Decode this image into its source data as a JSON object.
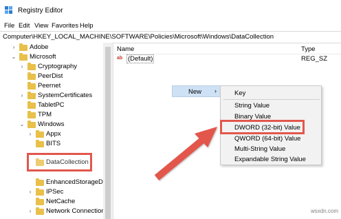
{
  "window": {
    "title": "Registry Editor"
  },
  "menu": [
    "File",
    "Edit",
    "View",
    "Favorites",
    "Help"
  ],
  "address": "Computer\\HKEY_LOCAL_MACHINE\\SOFTWARE\\Policies\\Microsoft\\Windows\\DataCollection",
  "tree": {
    "items": [
      {
        "label": "Adobe",
        "expander": "›"
      },
      {
        "label": "Microsoft",
        "expander": "⌄"
      },
      {
        "label": "Cryptography",
        "expander": "›"
      },
      {
        "label": "PeerDist",
        "expander": ""
      },
      {
        "label": "Peernet",
        "expander": ""
      },
      {
        "label": "SystemCertificates",
        "expander": "›"
      },
      {
        "label": "TabletPC",
        "expander": ""
      },
      {
        "label": "TPM",
        "expander": ""
      },
      {
        "label": "Windows",
        "expander": "⌄"
      },
      {
        "label": "Appx",
        "expander": "›"
      },
      {
        "label": "BITS",
        "expander": ""
      },
      {
        "label": "DataCollection",
        "expander": ""
      },
      {
        "label": "EnhancedStorageDev",
        "expander": ""
      },
      {
        "label": "IPSec",
        "expander": "›"
      },
      {
        "label": "NetCache",
        "expander": ""
      },
      {
        "label": "Network Connections",
        "expander": "›"
      }
    ]
  },
  "columns": {
    "name": "Name",
    "type": "Type"
  },
  "values": [
    {
      "name": "(Default)",
      "type": "REG_SZ",
      "icon": "ab"
    }
  ],
  "context_menu": {
    "new_label": "New",
    "arrow": "›"
  },
  "submenu": {
    "items": [
      "Key",
      "String Value",
      "Binary Value",
      "DWORD (32-bit) Value",
      "QWORD (64-bit) Value",
      "Multi-String Value",
      "Expandable String Value"
    ]
  },
  "watermark": "wsxdn.com",
  "colors": {
    "highlight": "#e2574c",
    "folder": "#e8c04a",
    "menu_hover": "#cfe1f5"
  }
}
